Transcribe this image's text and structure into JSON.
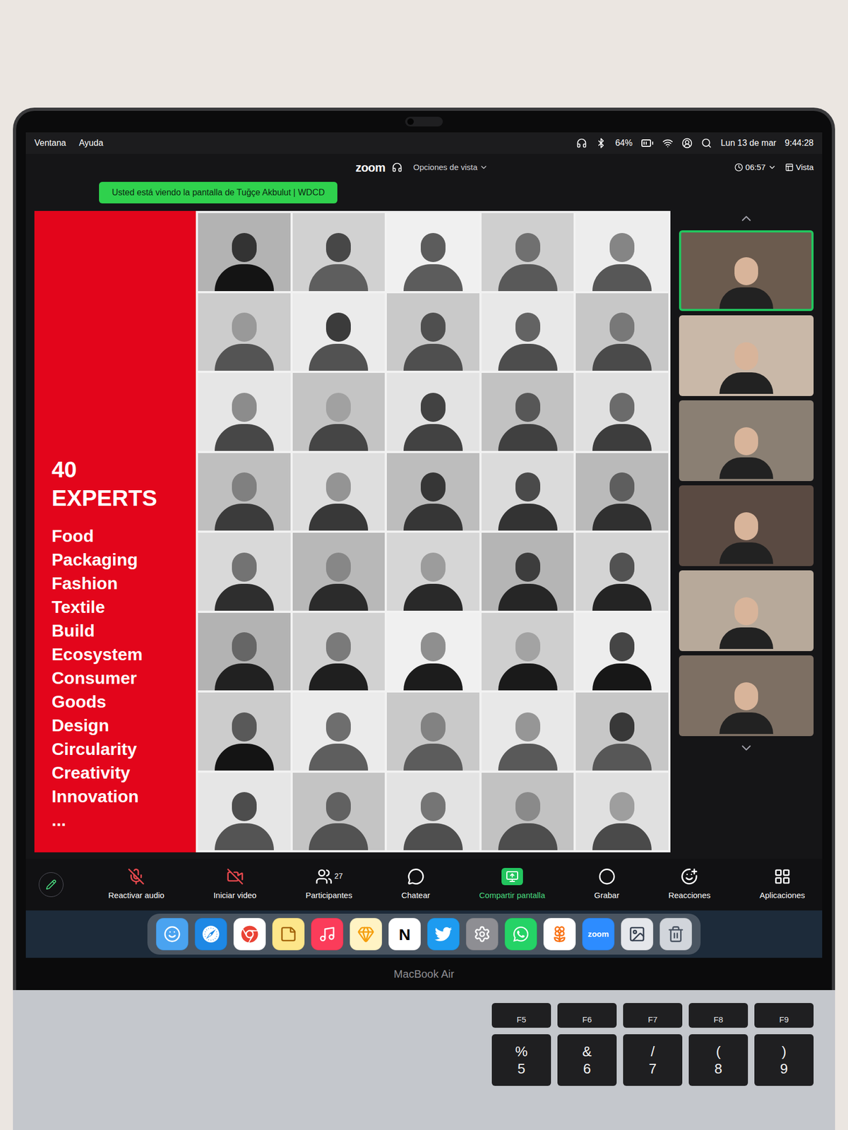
{
  "menu_bar": {
    "menus": [
      "Ventana",
      "Ayuda"
    ],
    "battery": "64%",
    "date": "Lun 13 de mar",
    "time": "9:44:28"
  },
  "zoom_bar": {
    "logo": "zoom",
    "view_options": "Opciones de vista",
    "banner": "Usted está viendo la pantalla de Tuğçe Akbulut | WDCD",
    "timer": "06:57",
    "view": "Vista"
  },
  "slide": {
    "title": "40 EXPERTS",
    "topics": [
      "Food",
      "Packaging",
      "Fashion",
      "Textile",
      "Build",
      "Ecosystem",
      "Consumer",
      "Goods",
      "Design",
      "Circularity",
      "Creativity",
      "Innovation",
      "..."
    ]
  },
  "participants": [
    {
      "speaking": true
    },
    {
      "speaking": false
    },
    {
      "speaking": false
    },
    {
      "speaking": false
    },
    {
      "speaking": false
    },
    {
      "speaking": false
    }
  ],
  "toolbar": [
    {
      "kind": "audio",
      "label": "Reactivar audio",
      "off": true
    },
    {
      "kind": "video",
      "label": "Iniciar video",
      "off": true
    },
    {
      "kind": "participants",
      "label": "Participantes",
      "count": "27",
      "off": false
    },
    {
      "kind": "chat",
      "label": "Chatear",
      "off": false
    },
    {
      "kind": "share",
      "label": "Compartir pantalla",
      "off": false
    },
    {
      "kind": "record",
      "label": "Grabar",
      "off": false
    },
    {
      "kind": "reactions",
      "label": "Reacciones",
      "off": false
    },
    {
      "kind": "apps",
      "label": "Aplicaciones",
      "off": false
    }
  ],
  "dock": [
    {
      "kind": "finder",
      "color": "#4aa3f0"
    },
    {
      "kind": "safari",
      "color": "#1e88e5"
    },
    {
      "kind": "chrome",
      "color": "#ffffff"
    },
    {
      "kind": "notes",
      "color": "#fde68a"
    },
    {
      "kind": "music",
      "color": "#fb3c5a"
    },
    {
      "kind": "sketch",
      "color": "#fff3c4"
    },
    {
      "kind": "notion",
      "color": "#ffffff",
      "text": "N"
    },
    {
      "kind": "twitter",
      "color": "#1d9bf0"
    },
    {
      "kind": "settings",
      "color": "#8e8e93"
    },
    {
      "kind": "whatsapp",
      "color": "#25d366"
    },
    {
      "kind": "photos",
      "color": "#ffffff"
    },
    {
      "kind": "zoom",
      "color": "#2d8cff",
      "text": "zoom"
    },
    {
      "kind": "preview",
      "color": "#e5e7eb"
    },
    {
      "kind": "trash",
      "color": "#d1d5db"
    }
  ],
  "laptop_label": "MacBook Air",
  "keyboard": {
    "function_keys": [
      "F5",
      "F6",
      "F7",
      "F8",
      "F9"
    ],
    "number_keys": [
      {
        "top": "%",
        "bottom": "5"
      },
      {
        "top": "&",
        "bottom": "6"
      },
      {
        "top": "/",
        "bottom": "7"
      },
      {
        "top": "(",
        "bottom": "8"
      },
      {
        "top": ")",
        "bottom": "9"
      }
    ]
  }
}
